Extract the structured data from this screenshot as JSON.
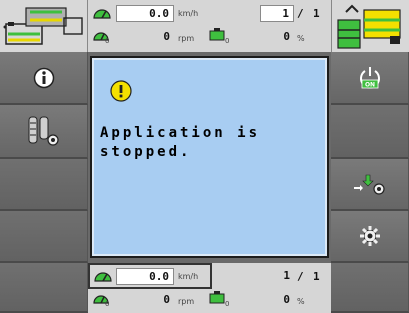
{
  "top_status": {
    "speed_value": "0.0",
    "speed_unit": "km/h",
    "rpm_value": "0",
    "rpm_unit": "rpm",
    "percent_value": "0",
    "percent_unit": "%",
    "page_current": "1",
    "page_separator": "/",
    "page_total": "1",
    "speed_icon_sub": "",
    "rpm_icon_sub": "0",
    "tank_icon_sub": "0"
  },
  "bottom_status": {
    "speed_value": "0.0",
    "speed_unit": "km/h",
    "rpm_value": "0",
    "rpm_unit": "rpm",
    "percent_value": "0",
    "percent_unit": "%",
    "page_current": "1",
    "page_separator": "/",
    "page_total": "1",
    "rpm_icon_sub": "0",
    "tank_icon_sub": "0"
  },
  "dialog": {
    "message": "Application is\nstopped.",
    "icon": "warning-icon"
  },
  "left_buttons": [
    {
      "icon": "info-icon"
    },
    {
      "icon": "sensor-settings-icon"
    },
    {
      "icon": ""
    },
    {
      "icon": ""
    },
    {
      "icon": ""
    }
  ],
  "right_buttons": [
    {
      "icon": "power-on-icon",
      "label": "ON"
    },
    {
      "icon": ""
    },
    {
      "icon": "transfer-settings-icon"
    },
    {
      "icon": "settings-gear-icon"
    },
    {
      "icon": ""
    }
  ],
  "colors": {
    "dialog_bg": "#a8cdf2",
    "panel_bg": "#6a6a6a",
    "status_bg": "#d6d6d6",
    "warning_yellow": "#f4e000",
    "accent_green": "#3fbf3f"
  }
}
